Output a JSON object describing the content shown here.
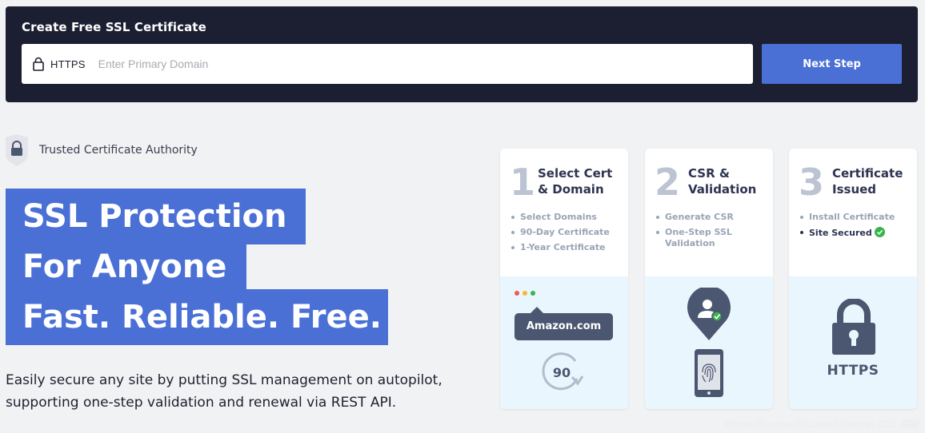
{
  "banner": {
    "title": "Create Free SSL Certificate",
    "protocol_label": "HTTPS",
    "domain_placeholder": "Enter Primary Domain",
    "domain_value": "",
    "next_label": "Next Step"
  },
  "trust": {
    "label": "Trusted Certificate Authority"
  },
  "headline": {
    "line1": "SSL Protection",
    "line2": "For Anyone",
    "line3": "Fast. Reliable. Free."
  },
  "description": "Easily secure any site by putting SSL management on autopilot, supporting one-step validation and renewal via REST API.",
  "steps": [
    {
      "number": "1",
      "title": "Select Cert & Domain",
      "items": [
        "Select Domains",
        "90-Day Certificate",
        "1-Year Certificate"
      ],
      "badge_text": "Amazon.com",
      "renew_days": "90"
    },
    {
      "number": "2",
      "title": "CSR & Validation",
      "items": [
        "Generate CSR",
        "One-Step SSL Validation"
      ]
    },
    {
      "number": "3",
      "title": "Certificate Issued",
      "items": [
        "Install Certificate",
        "Site Secured"
      ],
      "art_label": "HTTPS"
    }
  ],
  "colors": {
    "banner_bg": "#1c1f32",
    "accent": "#4a70d6",
    "card_art_bg": "#e9f6fd",
    "success": "#35b54a",
    "icon_dark": "#4b5670"
  },
  "watermark": "https://tw.onechil.com/channel-SSL 憑證"
}
